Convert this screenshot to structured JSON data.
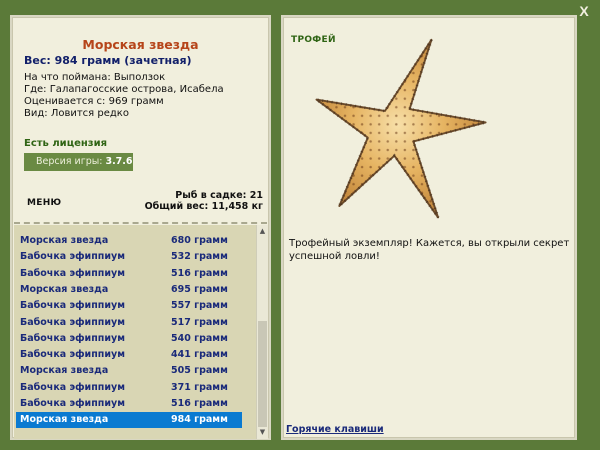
{
  "window": {
    "close_label": "X"
  },
  "fish_info": {
    "title": "Морская звезда",
    "weight_line": "Вес: 984 грамм (зачетная)",
    "lines": [
      "На что поймана: Выползок",
      "Где: Галапагосские острова, Исабела",
      "Оценивается с: 969 грамм",
      "Вид: Ловится редко"
    ]
  },
  "license": {
    "label": "Есть лицензия"
  },
  "version": {
    "label": "Версия игры:",
    "value": "3.7.6"
  },
  "menu": {
    "label": "МЕНЮ"
  },
  "stats": {
    "fish_count": "Рыб в садке: 21",
    "total_weight": "Общий вес: 11,458 кг"
  },
  "fish_list": [
    {
      "name": "Морская звезда",
      "weight": "680 грамм"
    },
    {
      "name": "Бабочка эфиппиум",
      "weight": "532 грамм"
    },
    {
      "name": "Бабочка эфиппиум",
      "weight": "516 грамм"
    },
    {
      "name": "Морская звезда",
      "weight": "695 грамм"
    },
    {
      "name": "Бабочка эфиппиум",
      "weight": "557 грамм"
    },
    {
      "name": "Бабочка эфиппиум",
      "weight": "517 грамм"
    },
    {
      "name": "Бабочка эфиппиум",
      "weight": "540 грамм"
    },
    {
      "name": "Бабочка эфиппиум",
      "weight": "441 грамм"
    },
    {
      "name": "Морская звезда",
      "weight": "505 грамм"
    },
    {
      "name": "Бабочка эфиппиум",
      "weight": "371 грамм"
    },
    {
      "name": "Бабочка эфиппиум",
      "weight": "516 грамм"
    },
    {
      "name": "Морская звезда",
      "weight": "984 грамм"
    }
  ],
  "selected_index": 11,
  "trophy": {
    "label": "ТРОФЕЙ",
    "image": "starfish-image",
    "text": "Трофейный экземпляр! Кажется, вы открыли секрет успешной ловли!"
  },
  "hotkeys": {
    "label": "Горячие клавиши"
  },
  "colors": {
    "background": "#5b7a39",
    "panel": "#f1efdd",
    "list_background": "#d9d6b4",
    "selected_row": "#0a7ad1",
    "fish_title": "#b6451a",
    "link": "#1a2a7a",
    "accent_green": "#2f6414"
  }
}
